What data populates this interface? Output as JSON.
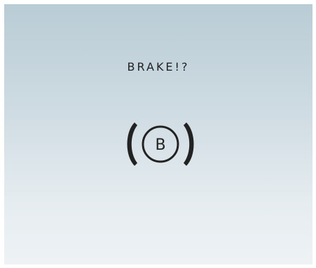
{
  "display": {
    "warning_text": "BRAKE!?",
    "brake_icon_letter": "B",
    "icon": "parking-brake-icon"
  },
  "colors": {
    "background_top": "#b9ccd5",
    "background_bottom": "#eef2f5",
    "icon_color": "#222222",
    "text_color": "#222222"
  }
}
